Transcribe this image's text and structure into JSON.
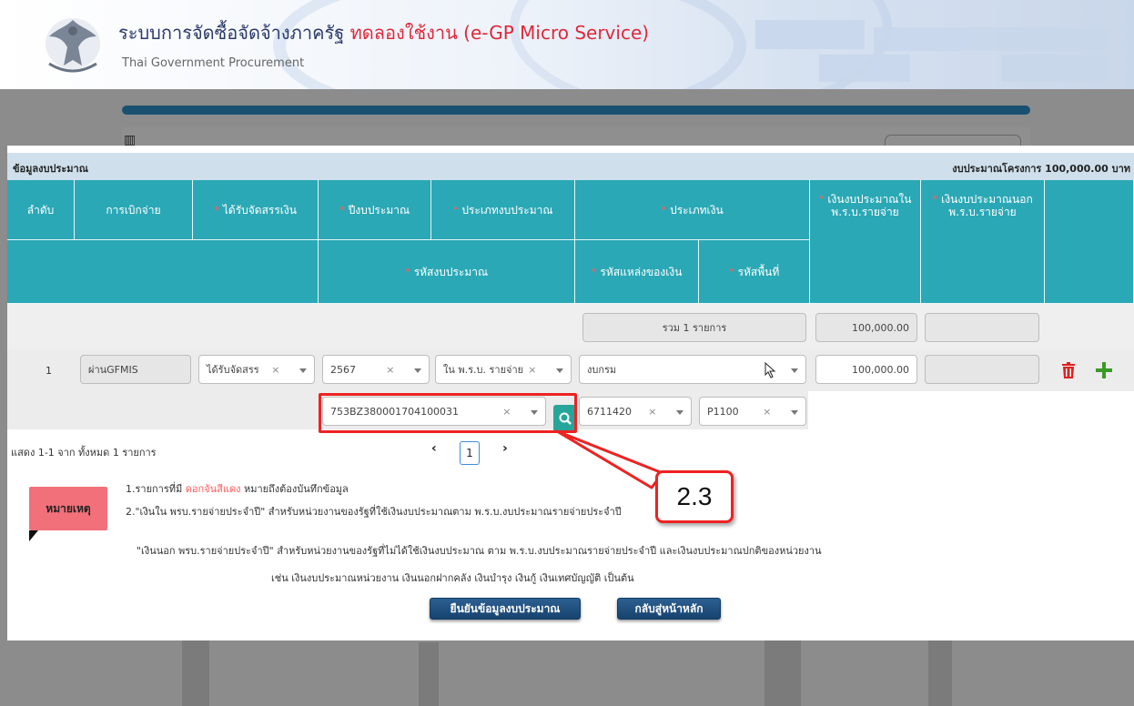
{
  "header": {
    "title_main": "ระบบการจัดซื้อจัดจ้างภาครัฐ",
    "title_trial": "ทดลองใช้งาน (e-GP Micro Service)",
    "subtitle": "Thai Government Procurement"
  },
  "section": {
    "label": "ข้อมูลงบประมาณ",
    "project_budget": "งบประมาณโครงการ 100,000.00 บาท"
  },
  "table": {
    "headers": {
      "seq": "ลำดับ",
      "disbursement": "การเบิกจ่าย",
      "allocation": "ได้รับจัดสรรเงิน",
      "fiscal_year": "ปีงบประมาณ",
      "budget_type": "ประเภทงบประมาณ",
      "money_type": "ประเภทเงิน",
      "budget_in_act": "เงินงบประมาณใน พ.ร.บ.รายจ่าย",
      "budget_out_act": "เงินงบประมาณนอก พ.ร.บ.รายจ่าย",
      "budget_code": "รหัสงบประมาณ",
      "fund_source_code": "รหัสแหล่งของเงิน",
      "area_code": "รหัสพื้นที่"
    },
    "summary": {
      "count_text": "รวม 1 รายการ",
      "total_in_act": "100,000.00",
      "total_out_act": ""
    },
    "row": {
      "seq": "1",
      "disbursement": "ผ่านGFMIS",
      "allocation": "ได้รับจัดสรร",
      "fiscal_year": "2567",
      "budget_type": "ใน พ.ร.บ. รายจ่าย",
      "money_type": "งบกรม",
      "budget_in_act": "100,000.00",
      "budget_out_act": "",
      "budget_code": "753BZ380001704100031",
      "fund_source_code": "6711420",
      "area_code": "P1100"
    }
  },
  "pagination": {
    "info": "แสดง 1-1 จาก ทั้งหมด 1 รายการ",
    "page": "1",
    "prev": "‹",
    "next": "›"
  },
  "annotation": {
    "step_label": "2.3"
  },
  "notes": {
    "badge": "หมายเหตุ",
    "line1_prefix": "1.รายการที่มี",
    "line1_red": "ดอกจันสีแดง",
    "line1_suffix": "หมายถึงต้องบันทึกข้อมูล",
    "line2": "2.\"เงินใน พรบ.รายจ่ายประจำปี\" สำหรับหน่วยงานของรัฐที่ใช้เงินงบประมาณตาม พ.ร.บ.งบประมาณรายจ่ายประจำปี",
    "line3": "\"เงินนอก พรบ.รายจ่ายประจำปี\" สำหรับหน่วยงานของรัฐที่ไม่ได้ใช้เงินงบประมาณ ตาม พ.ร.บ.งบประมาณรายจ่ายประจำปี และเงินงบประมาณปกติของหน่วยงาน",
    "line4": "เช่น เงินงบประมาณหน่วยงาน เงินนอกฝากคลัง เงินบำรุง เงินกู้ เงินเทศบัญญัติ เป็นต้น"
  },
  "buttons": {
    "confirm": "ยืนยันข้อมูลงบประมาณ",
    "back": "กลับสู่หน้าหลัก"
  },
  "colors": {
    "table_header": "#2aa8b6",
    "callout_red": "#e22222",
    "search_button": "#26a69a",
    "primary_button": "#1f4f80"
  }
}
